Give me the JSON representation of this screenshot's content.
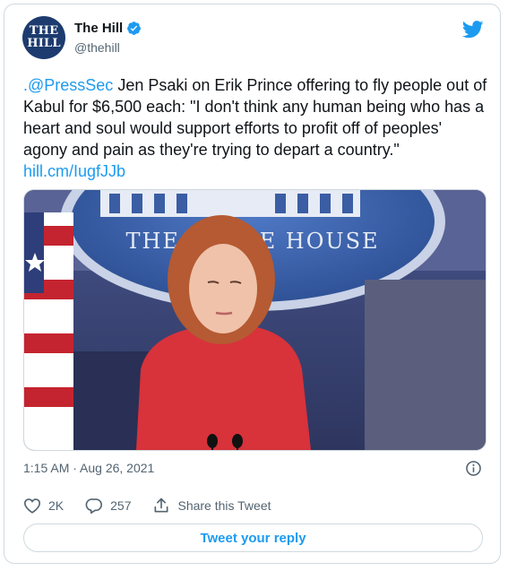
{
  "author": {
    "avatar_line1": "THE",
    "avatar_line2": "HILL",
    "display_name": "The Hill",
    "handle": "@thehill",
    "verified_icon": "verified-badge-icon"
  },
  "tweet": {
    "mention": ".@PressSec",
    "text": " Jen Psaki on Erik Prince offering to fly people out of Kabul for $6,500 each: \"I don't think any human being who has a heart and soul would support efforts to profit off of peoples' agony and pain as they're trying to depart a country.\" ",
    "link": "hill.cm/IugfJJb",
    "media_seal_text": "THE WHITE HOUSE",
    "timestamp": "1:15 AM · Aug 26, 2021"
  },
  "actions": {
    "likes": "2K",
    "replies": "257",
    "share_label": "Share this Tweet",
    "reply_button": "Tweet your reply"
  },
  "colors": {
    "accent": "#1d9bf0",
    "muted": "#536471",
    "border": "#cfd9de"
  }
}
